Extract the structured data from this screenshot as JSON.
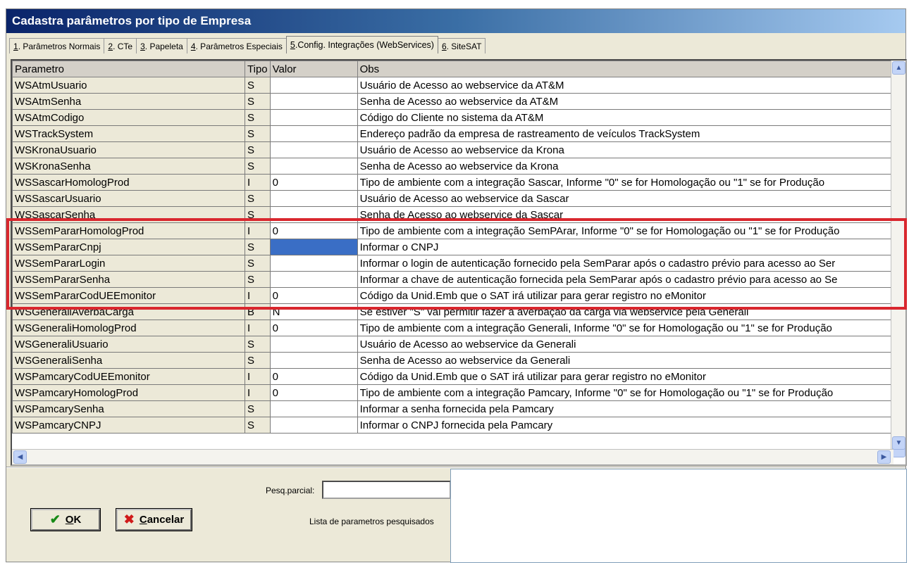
{
  "window": {
    "title": "Cadastra parâmetros por tipo de Empresa"
  },
  "tabs": [
    {
      "num": "1",
      "label": ". Parâmetros Normais",
      "active": false
    },
    {
      "num": "2",
      "label": ". CTe",
      "active": false
    },
    {
      "num": "3",
      "label": ". Papeleta",
      "active": false
    },
    {
      "num": "4",
      "label": ". Parâmetros Especiais",
      "active": false
    },
    {
      "num": "5",
      "label": ".Config. Integrações (WebServices)",
      "active": true
    },
    {
      "num": "6",
      "label": ". SiteSAT",
      "active": false
    }
  ],
  "grid": {
    "headers": {
      "parametro": "Parametro",
      "tipo": "Tipo",
      "valor": "Valor",
      "obs": "Obs"
    },
    "rows": [
      {
        "parametro": "WSAtmUsuario",
        "tipo": "S",
        "valor": "",
        "obs": "Usuário de Acesso ao webservice da AT&M"
      },
      {
        "parametro": "WSAtmSenha",
        "tipo": "S",
        "valor": "",
        "obs": "Senha de Acesso ao webservice da AT&M"
      },
      {
        "parametro": "WSAtmCodigo",
        "tipo": "S",
        "valor": "",
        "obs": "Código do Cliente no sistema da AT&M"
      },
      {
        "parametro": "WSTrackSystem",
        "tipo": "S",
        "valor": "",
        "obs": "Endereço padrão da empresa de rastreamento de veículos TrackSystem"
      },
      {
        "parametro": "WSKronaUsuario",
        "tipo": "S",
        "valor": "",
        "obs": "Usuário de Acesso ao webservice da Krona"
      },
      {
        "parametro": "WSKronaSenha",
        "tipo": "S",
        "valor": "",
        "obs": "Senha de Acesso ao webservice da Krona"
      },
      {
        "parametro": "WSSascarHomologProd",
        "tipo": "I",
        "valor": "0",
        "obs": "Tipo de ambiente com a integração Sascar, Informe \"0\" se for Homologação ou \"1\" se for Produção"
      },
      {
        "parametro": "WSSascarUsuario",
        "tipo": "S",
        "valor": "",
        "obs": "Usuário de Acesso ao webservice da Sascar"
      },
      {
        "parametro": "WSSascarSenha",
        "tipo": "S",
        "valor": "",
        "obs": "Senha de Acesso ao webservice da Sascar"
      },
      {
        "parametro": "WSSemPararHomologProd",
        "tipo": "I",
        "valor": "0",
        "obs": "Tipo de ambiente com a integração SemPArar, Informe \"0\" se for Homologação ou \"1\" se for Produção"
      },
      {
        "parametro": "WSSemPararCnpj",
        "tipo": "S",
        "valor": "",
        "obs": "Informar o CNPJ",
        "selected": true
      },
      {
        "parametro": "WSSemPararLogin",
        "tipo": "S",
        "valor": "",
        "obs": "Informar o login de autenticação fornecido pela SemParar após o cadastro prévio para acesso ao Ser"
      },
      {
        "parametro": "WSSemPararSenha",
        "tipo": "S",
        "valor": "",
        "obs": "Informar a chave de autenticação fornecida pela SemParar após o cadastro prévio para acesso ao Se"
      },
      {
        "parametro": "WSSemPararCodUEEmonitor",
        "tipo": "I",
        "valor": "0",
        "obs": "Código da Unid.Emb que o SAT irá utilizar para gerar registro no eMonitor"
      },
      {
        "parametro": "WSGeneraliAverbaCarga",
        "tipo": "B",
        "valor": "N",
        "obs": "Se estiver \"S\" vai permitir fazer a averbação da carga via webservice pela Generali"
      },
      {
        "parametro": "WSGeneraliHomologProd",
        "tipo": "I",
        "valor": "0",
        "obs": "Tipo de ambiente com a integração Generali, Informe \"0\" se for Homologação ou \"1\" se for Produção"
      },
      {
        "parametro": "WSGeneraliUsuario",
        "tipo": "S",
        "valor": "",
        "obs": "Usuário de Acesso ao webservice da Generali"
      },
      {
        "parametro": "WSGeneraliSenha",
        "tipo": "S",
        "valor": "",
        "obs": "Senha de Acesso ao webservice da Generali"
      },
      {
        "parametro": "WSPamcaryCodUEEmonitor",
        "tipo": "I",
        "valor": "0",
        "obs": "Código da Unid.Emb que o SAT irá utilizar para gerar registro no eMonitor"
      },
      {
        "parametro": "WSPamcaryHomologProd",
        "tipo": "I",
        "valor": "0",
        "obs": "Tipo de ambiente com a integração Pamcary, Informe \"0\" se for Homologação ou \"1\" se for Produção"
      },
      {
        "parametro": "WSPamcarySenha",
        "tipo": "S",
        "valor": "",
        "obs": "Informar a senha fornecida pela Pamcary"
      },
      {
        "parametro": "WSPamcaryCNPJ",
        "tipo": "S",
        "valor": "",
        "obs": "Informar o CNPJ fornecida pela Pamcary"
      }
    ]
  },
  "buttons": {
    "ok": {
      "accel": "O",
      "rest": "K"
    },
    "cancel": {
      "accel": "C",
      "rest": "ancelar"
    }
  },
  "search": {
    "label": "Pesq.parcial:",
    "value": "",
    "results_label": "Lista de parametros pesquisados"
  },
  "colors": {
    "highlight": "#d9272e",
    "selection": "#3a6ec5"
  }
}
